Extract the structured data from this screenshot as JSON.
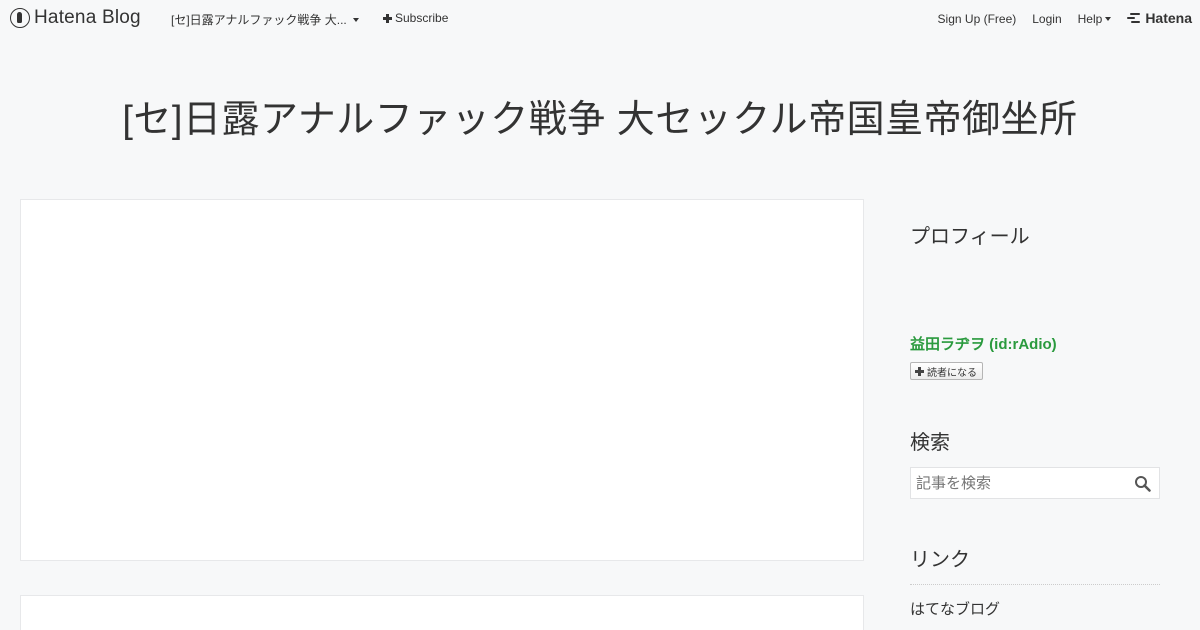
{
  "header": {
    "logo_text": "Hatena Blog",
    "blog_name": "[セ]日露アナルファック戦争 大...",
    "subscribe_label": "Subscribe",
    "signup_label": "Sign Up (Free)",
    "login_label": "Login",
    "help_label": "Help",
    "hatena_label": "Hatena"
  },
  "blog": {
    "title": "[セ]日露アナルファック戦争 大セックル帝国皇帝御坐所"
  },
  "sidebar": {
    "profile": {
      "title": "プロフィール",
      "name": "益田ラヂヲ (id:rAdio)",
      "subscribe_button": "読者になる"
    },
    "search": {
      "title": "検索",
      "placeholder": "記事を検索"
    },
    "links": {
      "title": "リンク",
      "items": [
        {
          "label": "はてなブログ"
        }
      ]
    }
  },
  "colors": {
    "background": "#f7f8f9",
    "profile_name": "#2a9a3e",
    "text": "#333333"
  }
}
